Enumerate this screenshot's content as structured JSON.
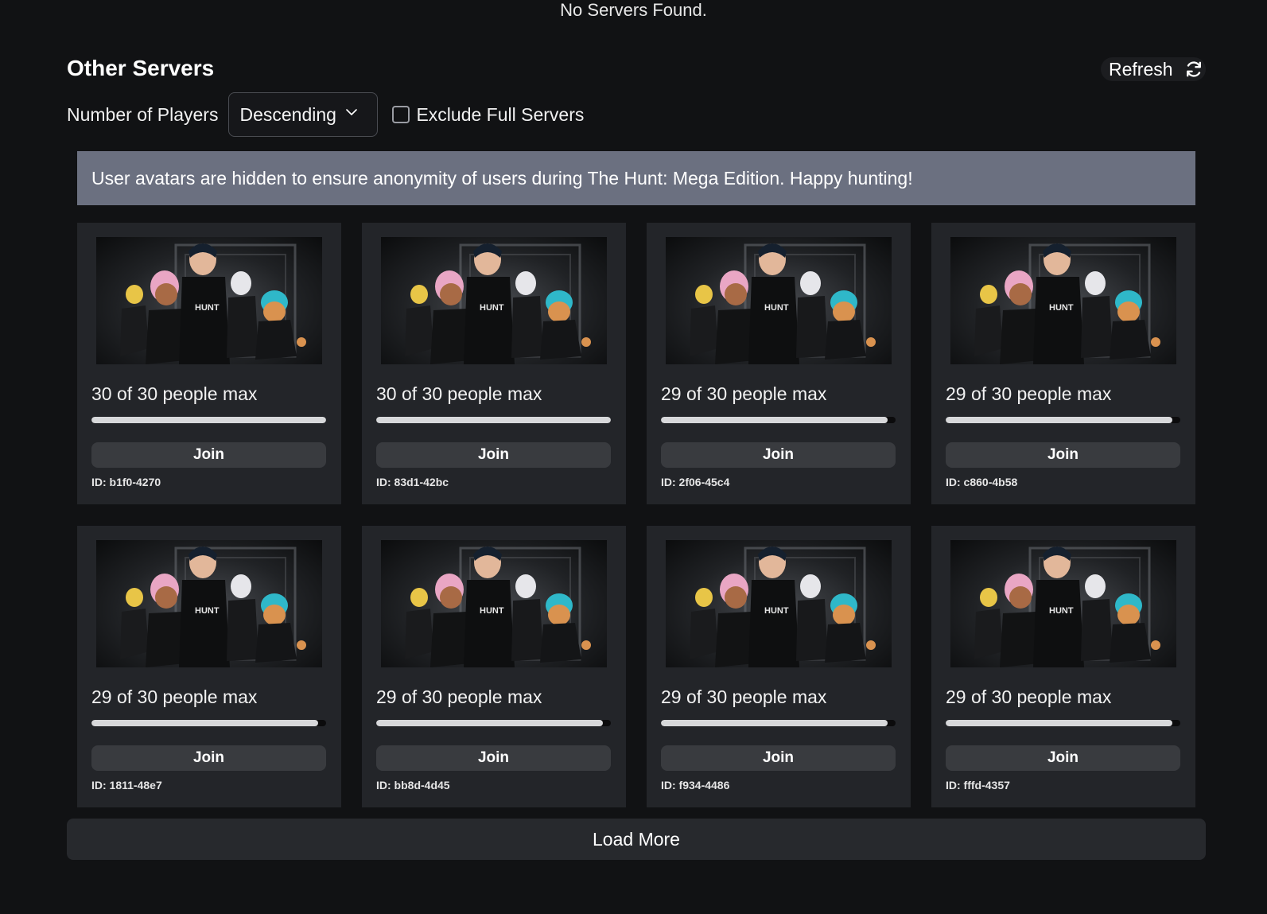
{
  "status": {
    "no_servers": "No Servers Found."
  },
  "section": {
    "title": "Other Servers",
    "refresh_label": "Refresh"
  },
  "filters": {
    "sort_label": "Number of Players",
    "sort_value": "Descending",
    "exclude_full_label": "Exclude Full Servers",
    "exclude_full_checked": false
  },
  "notice": "User avatars are hidden to ensure anonymity of users during The Hunt: Mega Edition. Happy hunting!",
  "servers": [
    {
      "players": "30 of 30 people max",
      "fill": 1.0,
      "join": "Join",
      "id": "ID: b1f0-4270"
    },
    {
      "players": "30 of 30 people max",
      "fill": 1.0,
      "join": "Join",
      "id": "ID: 83d1-42bc"
    },
    {
      "players": "29 of 30 people max",
      "fill": 0.967,
      "join": "Join",
      "id": "ID: 2f06-45c4"
    },
    {
      "players": "29 of 30 people max",
      "fill": 0.967,
      "join": "Join",
      "id": "ID: c860-4b58"
    },
    {
      "players": "29 of 30 people max",
      "fill": 0.967,
      "join": "Join",
      "id": "ID: 1811-48e7"
    },
    {
      "players": "29 of 30 people max",
      "fill": 0.967,
      "join": "Join",
      "id": "ID: bb8d-4d45"
    },
    {
      "players": "29 of 30 people max",
      "fill": 0.967,
      "join": "Join",
      "id": "ID: f934-4486"
    },
    {
      "players": "29 of 30 people max",
      "fill": 0.967,
      "join": "Join",
      "id": "ID: fffd-4357"
    }
  ],
  "load_more": "Load More",
  "icons": {
    "refresh": "refresh-icon",
    "dropdown": "chevron-down-icon",
    "thumbnail": "game-thumbnail-image"
  },
  "colors": {
    "background": "#111214",
    "card": "#232529",
    "notice": "#6b7080",
    "button": "#393b3f",
    "bar_fill": "#d7d8da"
  }
}
